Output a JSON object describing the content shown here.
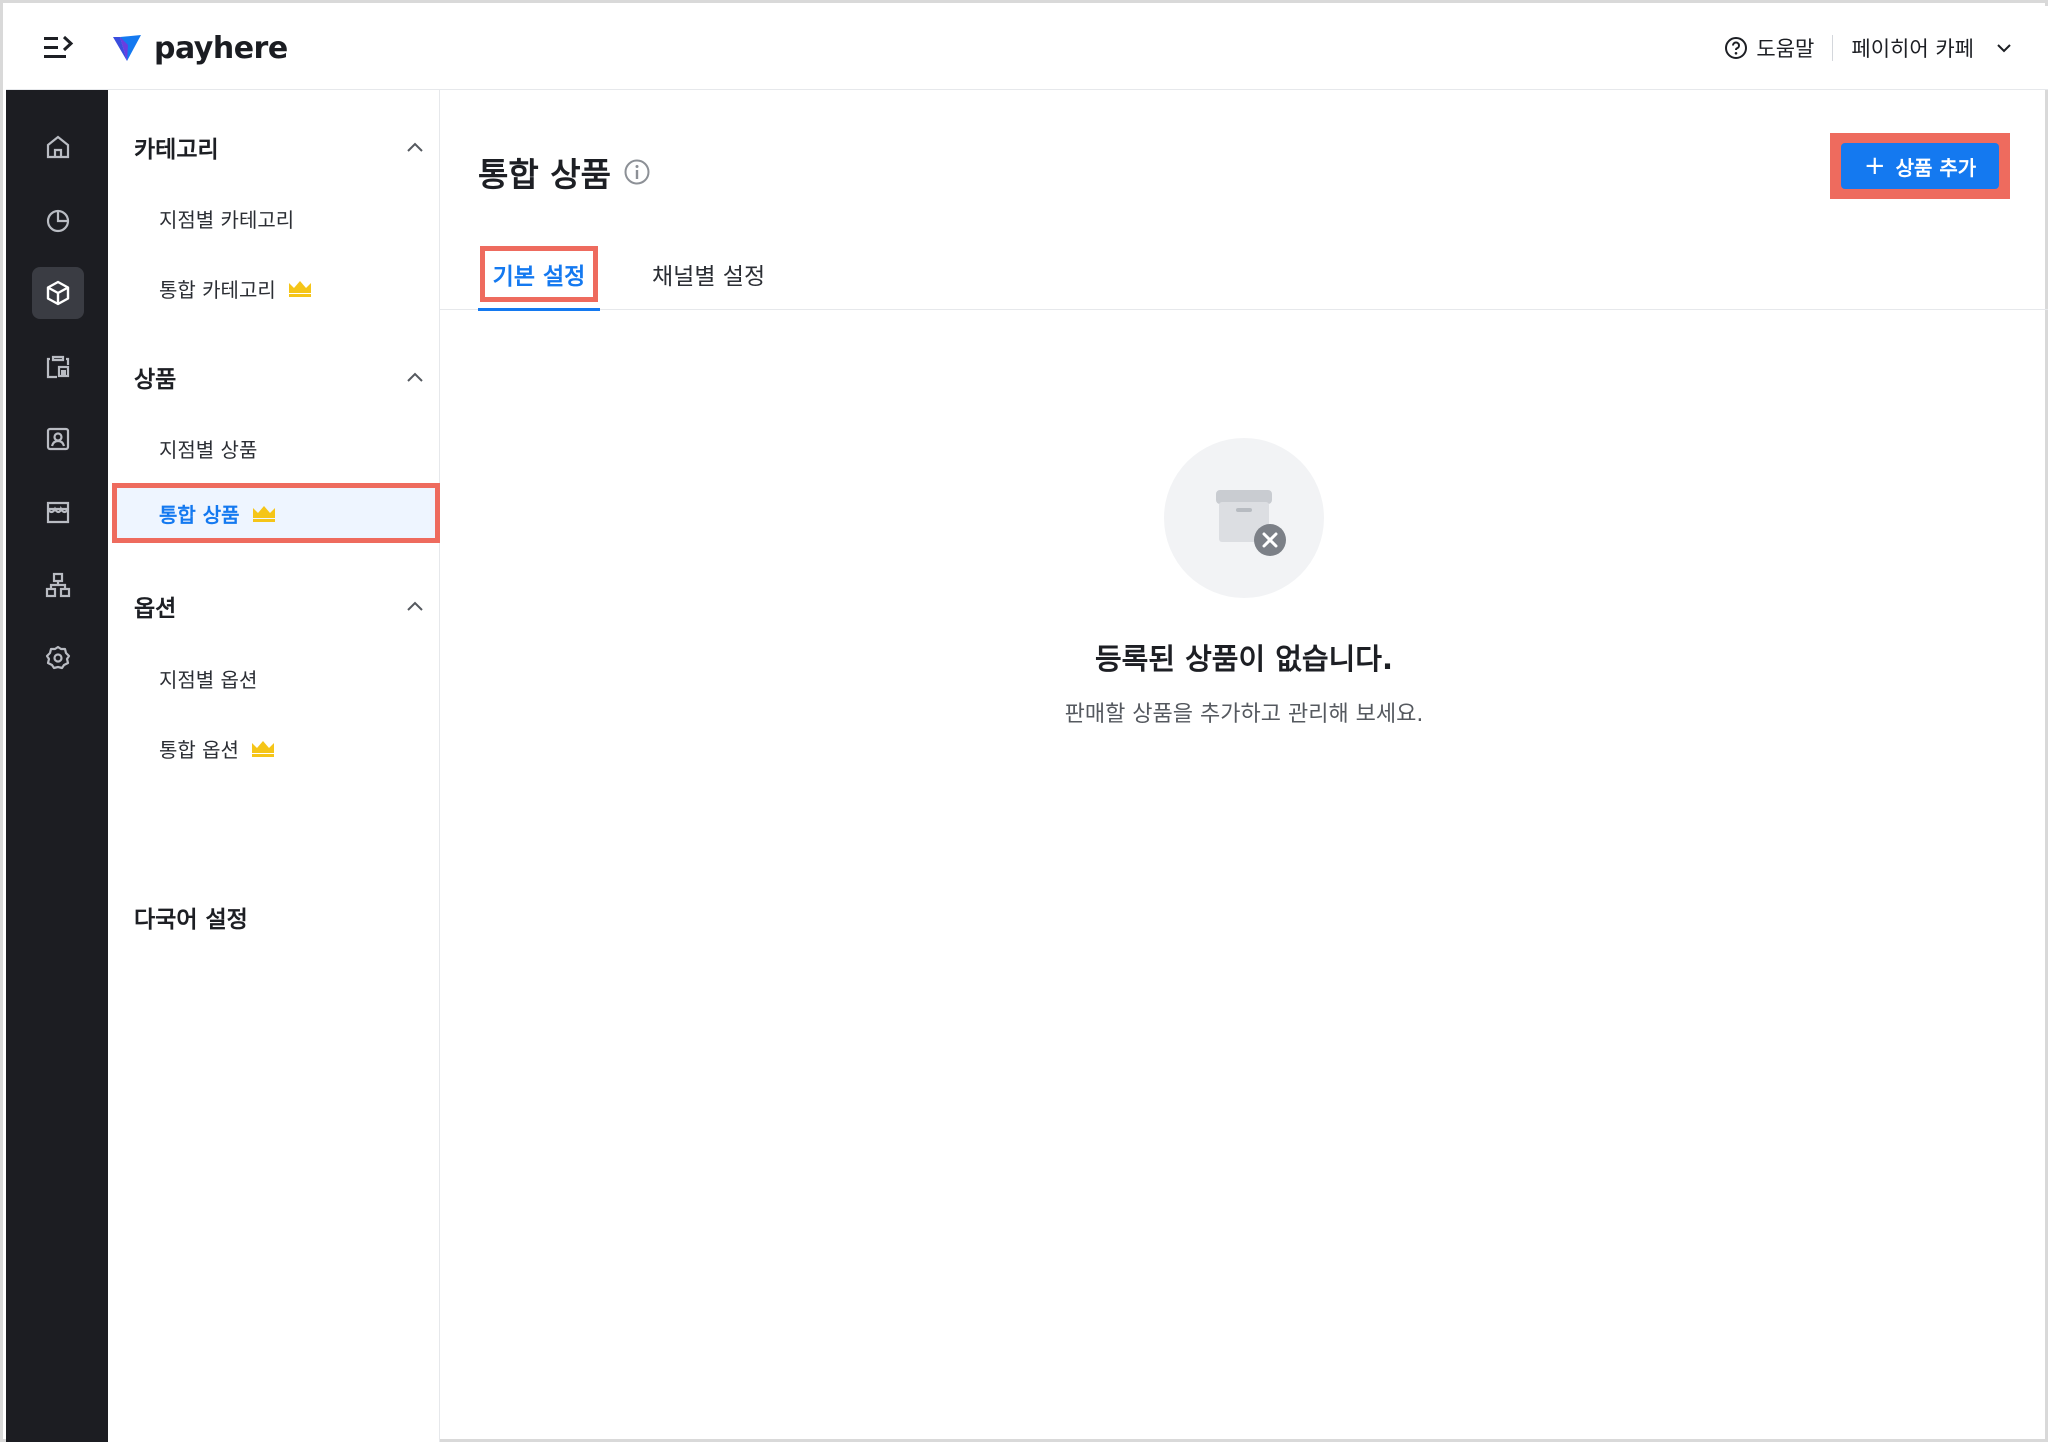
{
  "header": {
    "logo_text": "payhere",
    "help_label": "도움말",
    "store_name": "페이히어 카페"
  },
  "rail": {
    "items": [
      "home-icon",
      "chart-icon",
      "product-icon",
      "inventory-icon",
      "customer-icon",
      "store-icon",
      "org-icon",
      "settings-icon"
    ],
    "active": "product-icon"
  },
  "sidebar": {
    "groups": [
      {
        "title": "카테고리",
        "items": [
          {
            "label": "지점별 카테고리"
          },
          {
            "label": "통합 카테고리",
            "premium": true
          }
        ]
      },
      {
        "title": "상품",
        "items": [
          {
            "label": "지점별 상품"
          },
          {
            "label": "통합 상품",
            "premium": true,
            "active": true
          }
        ]
      },
      {
        "title": "옵션",
        "items": [
          {
            "label": "지점별 옵션"
          },
          {
            "label": "통합 옵션",
            "premium": true
          }
        ]
      }
    ],
    "multilang_label": "다국어 설정"
  },
  "main": {
    "title": "통합 상품",
    "add_button_label": "상품 추가",
    "tabs": [
      {
        "label": "기본 설정",
        "active": true
      },
      {
        "label": "채널별 설정"
      }
    ],
    "empty_state": {
      "title": "등록된 상품이 없습니다.",
      "description": "판매할 상품을 추가하고 관리해 보세요."
    }
  },
  "colors": {
    "accent": "#1479f0",
    "rail_bg": "#1c1d22",
    "highlight": "#ee6b5e",
    "crown": "#f5c518"
  }
}
